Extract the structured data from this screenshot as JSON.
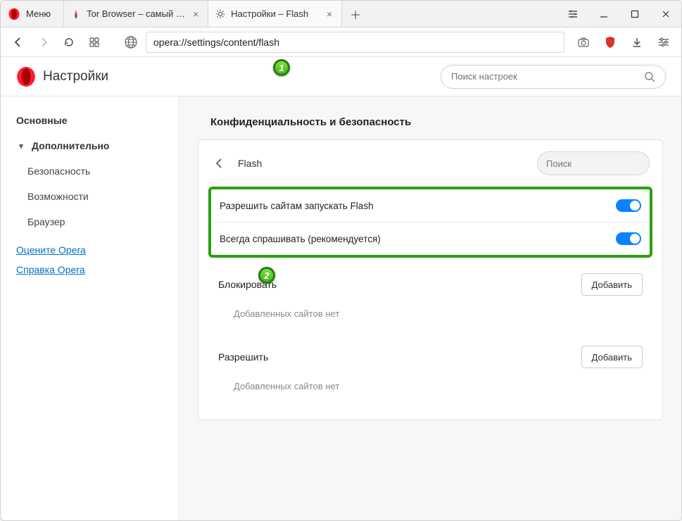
{
  "window": {
    "menu_label": "Меню",
    "tabs": [
      {
        "title": "Tor Browser – самый защи",
        "active": false,
        "icon": "tor"
      },
      {
        "title": "Настройки – Flash",
        "active": true,
        "icon": "gear"
      }
    ]
  },
  "url": "opera://settings/content/flash",
  "settings": {
    "heading": "Настройки",
    "search_placeholder": "Поиск настроек",
    "section_title": "Конфиденциальность и безопасность"
  },
  "sidebar": {
    "basic": "Основные",
    "advanced": "Дополнительно",
    "subs": [
      "Безопасность",
      "Возможности",
      "Браузер"
    ],
    "links": [
      "Оцените Opera",
      "Справка Opera"
    ]
  },
  "panel": {
    "title": "Flash",
    "search_placeholder": "Поиск",
    "toggles": [
      {
        "label": "Разрешить сайтам запускать Flash",
        "on": true
      },
      {
        "label": "Всегда спрашивать (рекомендуется)",
        "on": true
      }
    ],
    "block": {
      "label": "Блокировать",
      "add": "Добавить",
      "empty": "Добавленных сайтов нет"
    },
    "allow": {
      "label": "Разрешить",
      "add": "Добавить",
      "empty": "Добавленных сайтов нет"
    }
  },
  "annotations": {
    "one": "1",
    "two": "2"
  }
}
